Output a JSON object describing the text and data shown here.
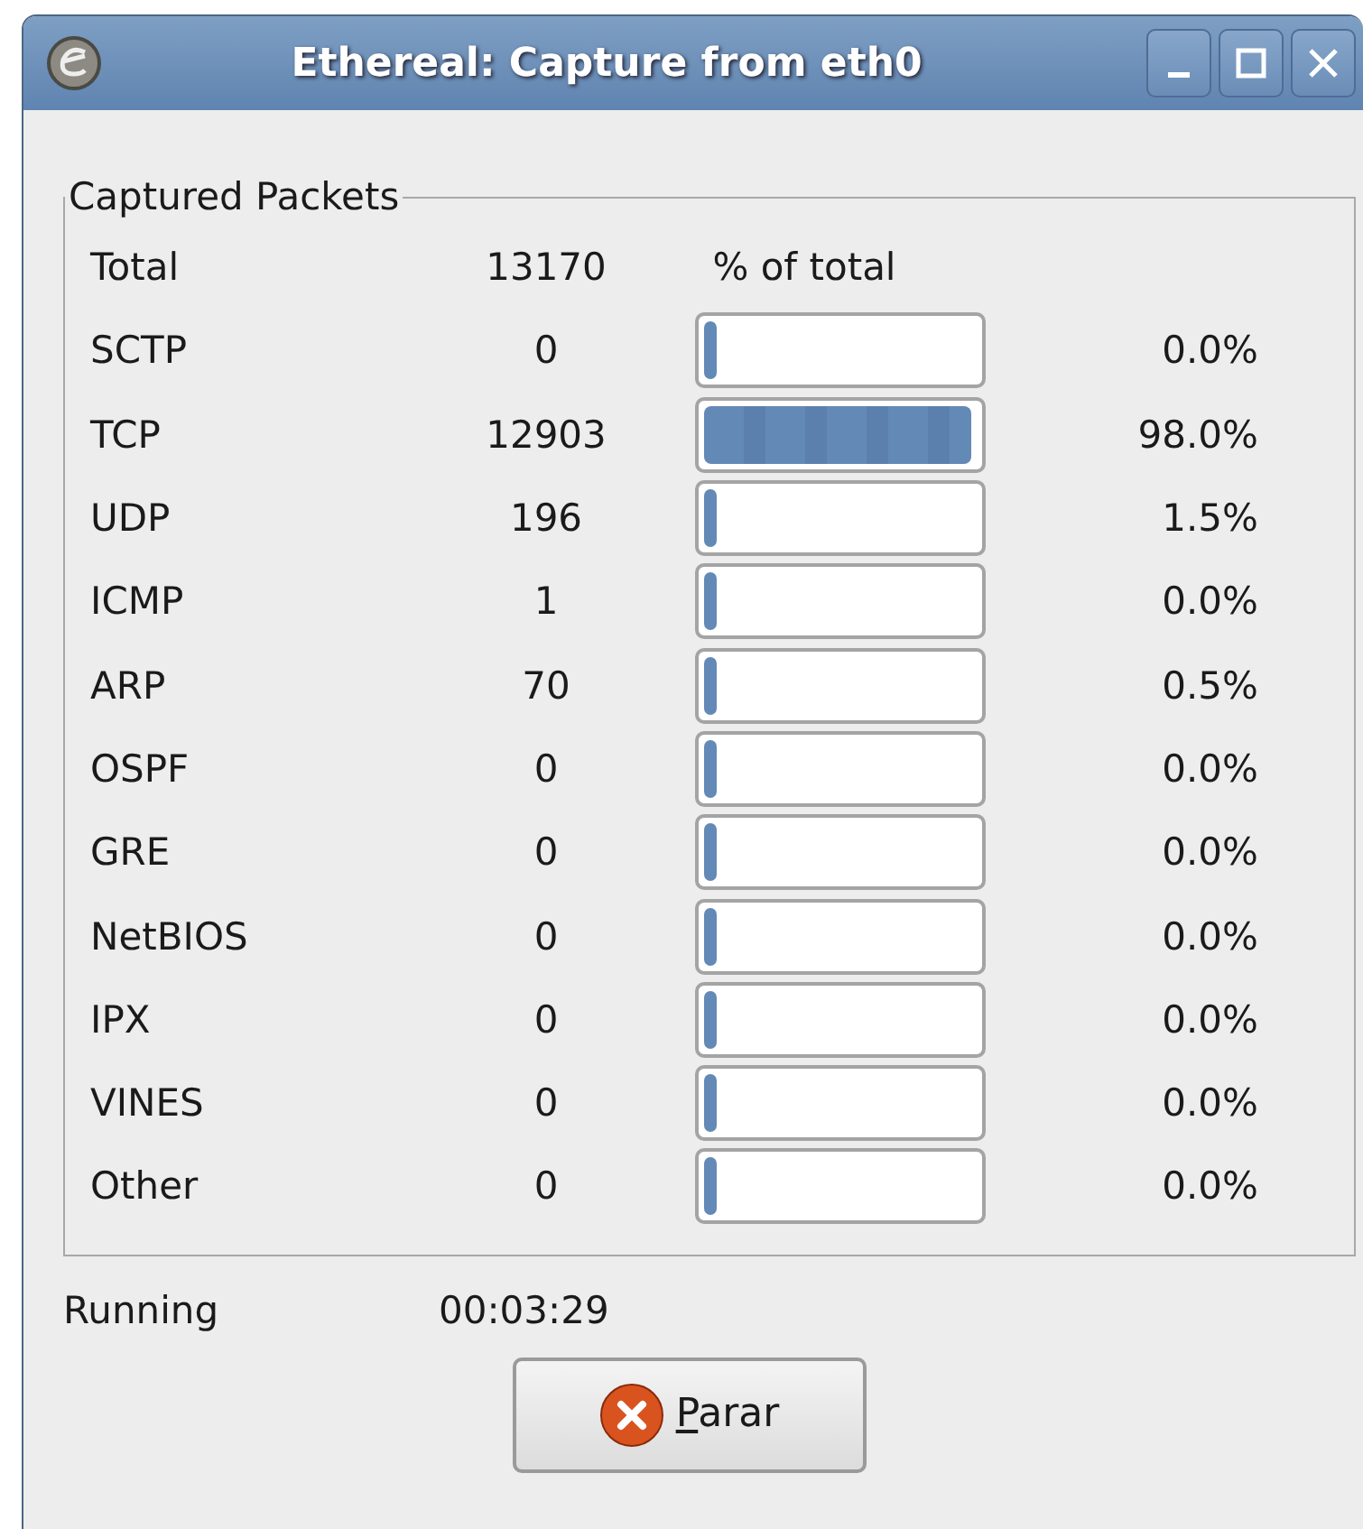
{
  "window": {
    "title": "Ethereal: Capture from eth0"
  },
  "frame": {
    "title": "Captured Packets"
  },
  "total": {
    "label": "Total",
    "count": "13170",
    "header": "% of total"
  },
  "protocols": [
    {
      "name": "SCTP",
      "count": "0",
      "level": 0,
      "percent": "0.0%"
    },
    {
      "name": "TCP",
      "count": "12903",
      "level": 0.98,
      "percent": "98.0%"
    },
    {
      "name": "UDP",
      "count": "196",
      "level": 0.015,
      "percent": "1.5%"
    },
    {
      "name": "ICMP",
      "count": "1",
      "level": 0,
      "percent": "0.0%"
    },
    {
      "name": "ARP",
      "count": "70",
      "level": 0.005,
      "percent": "0.5%"
    },
    {
      "name": "OSPF",
      "count": "0",
      "level": 0,
      "percent": "0.0%"
    },
    {
      "name": "GRE",
      "count": "0",
      "level": 0,
      "percent": "0.0%"
    },
    {
      "name": "NetBIOS",
      "count": "0",
      "level": 0,
      "percent": "0.0%"
    },
    {
      "name": "IPX",
      "count": "0",
      "level": 0,
      "percent": "0.0%"
    },
    {
      "name": "VINES",
      "count": "0",
      "level": 0,
      "percent": "0.0%"
    },
    {
      "name": "Other",
      "count": "0",
      "level": 0,
      "percent": "0.0%"
    }
  ],
  "status": {
    "label": "Running",
    "time": "00:03:29"
  },
  "button": {
    "label": "Parar"
  }
}
